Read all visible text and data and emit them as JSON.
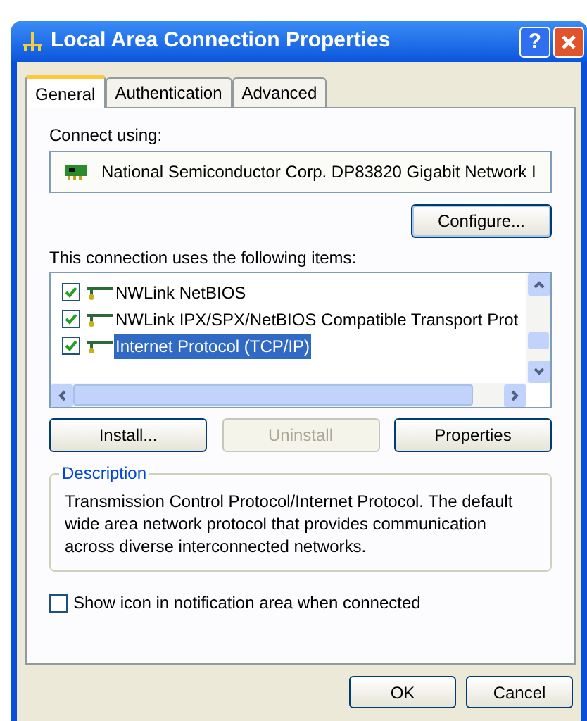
{
  "window": {
    "title": "Local Area Connection Properties",
    "help_button": "?"
  },
  "tabs": [
    {
      "label": "General",
      "selected": true
    },
    {
      "label": "Authentication",
      "selected": false
    },
    {
      "label": "Advanced",
      "selected": false
    }
  ],
  "connect_using": {
    "label": "Connect using:",
    "adapter": "National Semiconductor Corp. DP83820 Gigabit Network I",
    "configure_button": "Configure..."
  },
  "items_label": "This connection uses the following items:",
  "items": [
    {
      "label": "NWLink NetBIOS",
      "checked": true,
      "selected": false
    },
    {
      "label": "NWLink IPX/SPX/NetBIOS Compatible Transport Prot",
      "checked": true,
      "selected": false
    },
    {
      "label": "Internet Protocol (TCP/IP)",
      "checked": true,
      "selected": true
    }
  ],
  "item_buttons": [
    {
      "label": "Install...",
      "disabled": false
    },
    {
      "label": "Uninstall",
      "disabled": true
    },
    {
      "label": "Properties",
      "disabled": false
    }
  ],
  "description": {
    "title": "Description",
    "text": "Transmission Control Protocol/Internet Protocol. The default wide area network protocol that provides communication across diverse interconnected networks."
  },
  "notify_checkbox": {
    "label": "Show icon in notification area when connected",
    "checked": false
  },
  "buttons": [
    {
      "label": "OK"
    },
    {
      "label": "Cancel"
    }
  ]
}
